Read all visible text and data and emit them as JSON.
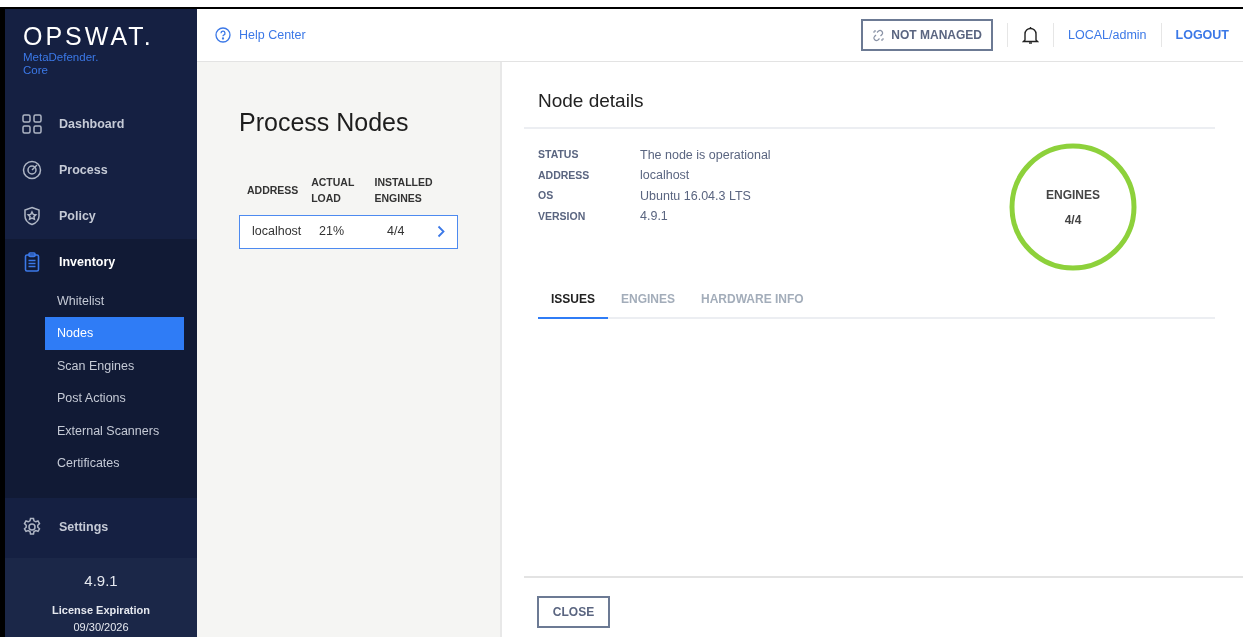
{
  "sidebar": {
    "logo": "OPSWAT.",
    "product": "MetaDefender.",
    "edition": "Core",
    "items": [
      {
        "label": "Dashboard",
        "selected": false,
        "expanded": false
      },
      {
        "label": "Process",
        "selected": false,
        "expanded": false
      },
      {
        "label": "Policy",
        "selected": false,
        "expanded": false
      },
      {
        "label": "Inventory",
        "selected": true,
        "expanded": true,
        "children": [
          {
            "label": "Whitelist",
            "selected": false
          },
          {
            "label": "Nodes",
            "selected": true
          },
          {
            "label": "Scan Engines",
            "selected": false
          },
          {
            "label": "Post Actions",
            "selected": false
          },
          {
            "label": "External Scanners",
            "selected": false
          },
          {
            "label": "Certificates",
            "selected": false
          }
        ]
      },
      {
        "label": "Settings",
        "selected": false,
        "expanded": false
      }
    ],
    "footer": {
      "version": "4.9.1",
      "license_label": "License Expiration",
      "license_date": "09/30/2026"
    }
  },
  "topbar": {
    "help": "Help Center",
    "not_managed": "NOT MANAGED",
    "user": "LOCAL/admin",
    "logout": "LOGOUT"
  },
  "nodes_panel": {
    "title": "Process Nodes",
    "columns": [
      "ADDRESS",
      "ACTUAL LOAD",
      "INSTALLED ENGINES"
    ],
    "rows": [
      {
        "cells": [
          "localhost",
          "21%",
          "4/4"
        ],
        "selected": true
      }
    ]
  },
  "details": {
    "title": "Node details",
    "fields": [
      {
        "label": "STATUS",
        "value": "The node is operational"
      },
      {
        "label": "ADDRESS",
        "value": "localhost"
      },
      {
        "label": "OS",
        "value": "Ubuntu 16.04.3 LTS"
      },
      {
        "label": "VERSION",
        "value": "4.9.1"
      }
    ],
    "engines": {
      "label": "ENGINES",
      "value": "4/4",
      "level": 1
    },
    "tabs": [
      {
        "label": "ISSUES",
        "selected": true
      },
      {
        "label": "ENGINES",
        "selected": false
      },
      {
        "label": "HARDWARE INFO",
        "selected": false
      }
    ],
    "close": "CLOSE"
  }
}
